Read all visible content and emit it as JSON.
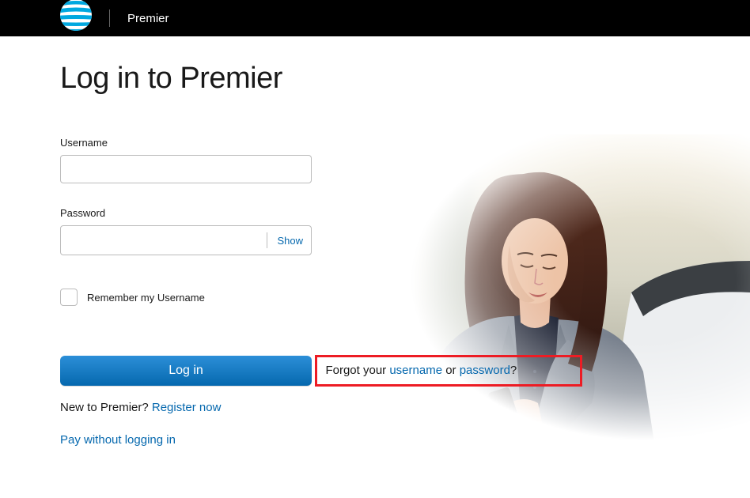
{
  "header": {
    "brand": "Premier"
  },
  "page": {
    "title": "Log in to Premier"
  },
  "form": {
    "username_label": "Username",
    "password_label": "Password",
    "show_toggle": "Show",
    "remember_label": "Remember my Username",
    "login_button": "Log in"
  },
  "links": {
    "forgot_prefix": "Forgot your ",
    "forgot_username": "username",
    "forgot_middle": " or ",
    "forgot_password": "password",
    "forgot_suffix": "?",
    "register_prefix": "New to Premier? ",
    "register_link": "Register now",
    "pay_without_login": "Pay without logging in"
  }
}
